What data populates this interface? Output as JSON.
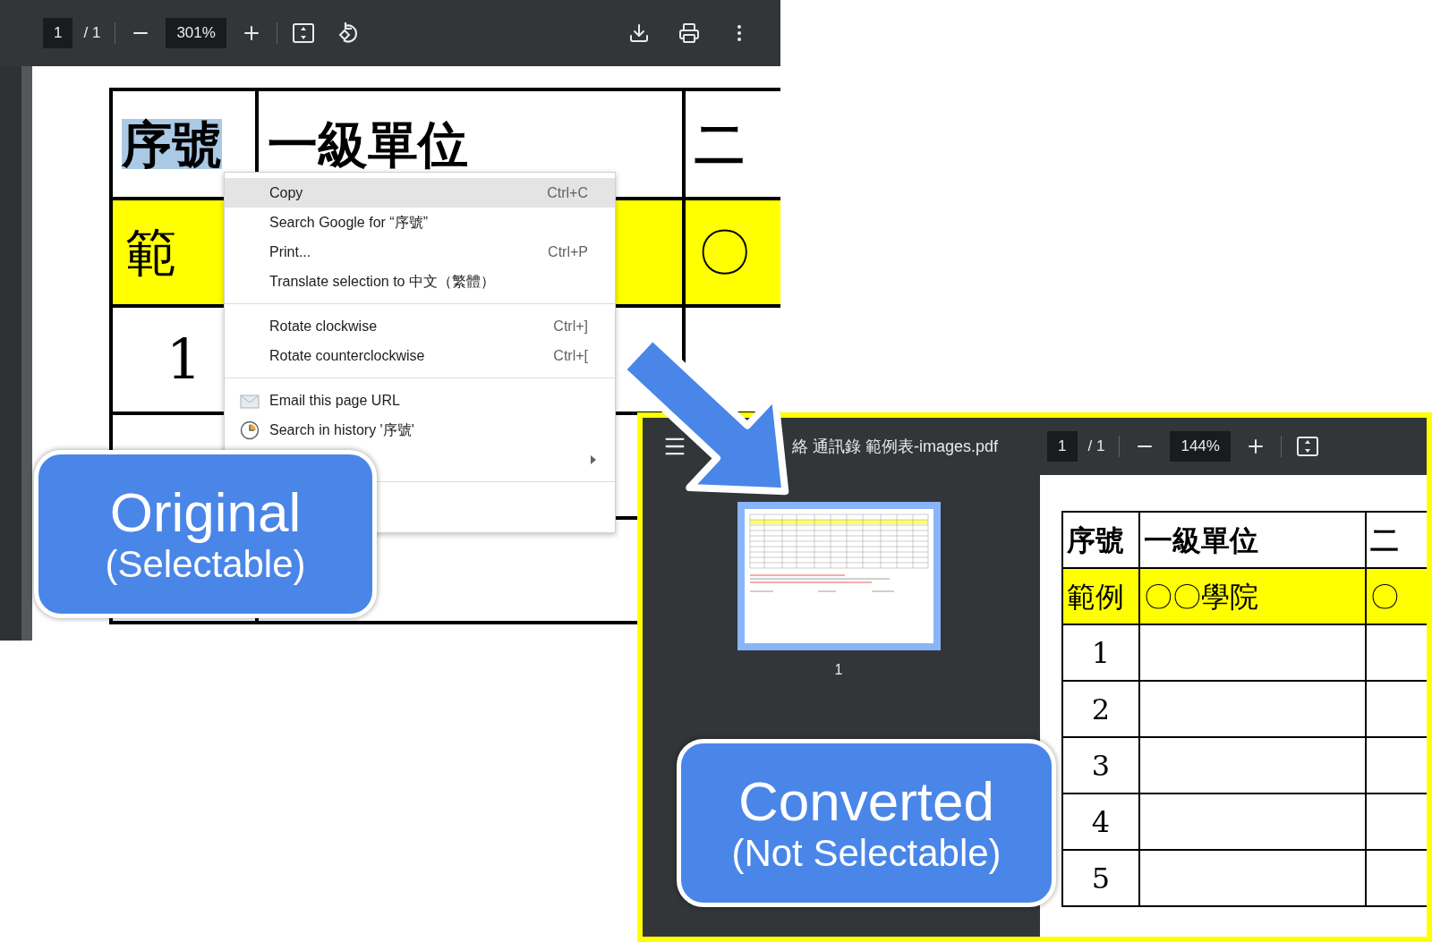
{
  "original_viewer": {
    "toolbar": {
      "page": "1",
      "page_total": "/ 1",
      "zoom": "301%"
    },
    "table": {
      "header": [
        {
          "text": "序號",
          "selected": true
        },
        {
          "text": "一級單位",
          "selected": false
        },
        {
          "text": "二",
          "selected": false
        }
      ],
      "rows": [
        {
          "highlight": true,
          "cells": [
            "範",
            null,
            "〇"
          ]
        },
        {
          "highlight": false,
          "cells": [
            "1",
            null,
            null
          ]
        }
      ]
    },
    "context_menu": [
      {
        "kind": "item",
        "label": "Copy",
        "shortcut": "Ctrl+C",
        "selected": true
      },
      {
        "kind": "item",
        "label": "Search Google for “序號”",
        "selected": false
      },
      {
        "kind": "item",
        "label": "Print...",
        "shortcut": "Ctrl+P",
        "selected": false
      },
      {
        "kind": "item",
        "label": "Translate selection to 中文（繁體）",
        "selected": false
      },
      {
        "kind": "separator"
      },
      {
        "kind": "item",
        "label": "Rotate clockwise",
        "shortcut": "Ctrl+]",
        "selected": false
      },
      {
        "kind": "item",
        "label": "Rotate counterclockwise",
        "shortcut": "Ctrl+[",
        "selected": false
      },
      {
        "kind": "separator"
      },
      {
        "kind": "email",
        "label": "Email this page URL",
        "selected": false
      },
      {
        "kind": "history",
        "label": "Search in history '序號'",
        "selected": false
      },
      {
        "kind": "submenu",
        "selected": false
      },
      {
        "kind": "separator"
      }
    ],
    "callout": {
      "title": "Original",
      "subtitle": "(Selectable)"
    }
  },
  "converted_viewer": {
    "toolbar": {
      "title": "絡 通訊錄 範例表-images.pdf",
      "page": "1",
      "page_total": "/ 1",
      "zoom": "144%"
    },
    "sidebar": {
      "thumbnails": [
        {
          "label": "1",
          "selected": true
        }
      ]
    },
    "table": {
      "header": [
        {
          "text": "序號"
        },
        {
          "text": "一級單位"
        },
        {
          "text": "二"
        }
      ],
      "rows": [
        {
          "highlight": true,
          "cells": [
            "範例",
            "〇〇學院",
            "〇"
          ]
        },
        {
          "highlight": false,
          "cells": [
            "1",
            null,
            null
          ]
        },
        {
          "highlight": false,
          "cells": [
            "2",
            null,
            null
          ]
        },
        {
          "highlight": false,
          "cells": [
            "3",
            null,
            null
          ]
        },
        {
          "highlight": false,
          "cells": [
            "4",
            null,
            null
          ]
        },
        {
          "highlight": false,
          "cells": [
            "5",
            null,
            null
          ]
        }
      ]
    },
    "callout": {
      "title": "Converted",
      "subtitle": "(Not Selectable)"
    }
  }
}
